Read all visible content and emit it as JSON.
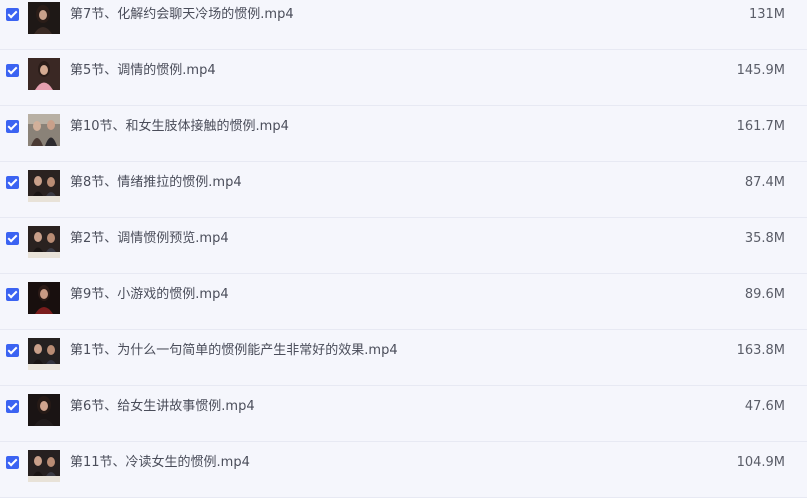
{
  "files": [
    {
      "name": "第7节、化解约会聊天冷场的惯例.mp4",
      "size": "131M",
      "checked": true,
      "icon": "video-thumbnail-woman-icon"
    },
    {
      "name": "第5节、调情的惯例.mp4",
      "size": "145.9M",
      "checked": true,
      "icon": "video-thumbnail-woman-icon"
    },
    {
      "name": "第10节、和女生肢体接触的惯例.mp4",
      "size": "161.7M",
      "checked": true,
      "icon": "video-thumbnail-couple-icon"
    },
    {
      "name": "第8节、情绪推拉的惯例.mp4",
      "size": "87.4M",
      "checked": true,
      "icon": "video-thumbnail-couple-icon"
    },
    {
      "name": "第2节、调情惯例预览.mp4",
      "size": "35.8M",
      "checked": true,
      "icon": "video-thumbnail-couple-icon"
    },
    {
      "name": "第9节、小游戏的惯例.mp4",
      "size": "89.6M",
      "checked": true,
      "icon": "video-thumbnail-woman-icon"
    },
    {
      "name": "第1节、为什么一句简单的惯例能产生非常好的效果.mp4",
      "size": "163.8M",
      "checked": true,
      "icon": "video-thumbnail-couple-icon"
    },
    {
      "name": "第6节、给女生讲故事惯例.mp4",
      "size": "47.6M",
      "checked": true,
      "icon": "video-thumbnail-woman-icon"
    },
    {
      "name": "第11节、冷读女生的惯例.mp4",
      "size": "104.9M",
      "checked": true,
      "icon": "video-thumbnail-couple-icon"
    }
  ],
  "colors": {
    "background": "#f5f6fc",
    "checkbox": "#3b63f2",
    "text": "#4a4d5a"
  }
}
